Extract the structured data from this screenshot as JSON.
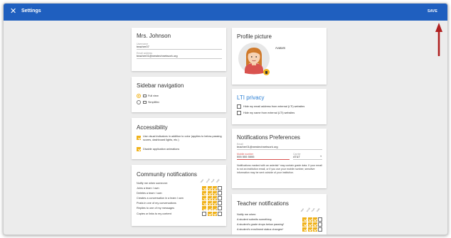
{
  "header": {
    "title": "Settings",
    "save_label": "SAVE",
    "close_icon": "close-icon",
    "color": "#1f5fbf"
  },
  "profile": {
    "name": "Mrs. Johnson",
    "username_label": "Username",
    "username": "teacher07",
    "email_label": "Email address",
    "email": "teacher01@newtechnetwork.org"
  },
  "sidebar_nav": {
    "title": "Sidebar navigation",
    "options": [
      {
        "label": "Full view",
        "selected": true
      },
      {
        "label": "Simplified",
        "selected": false
      }
    ]
  },
  "accessibility": {
    "title": "Accessibility",
    "options": [
      {
        "label": "Use visual indicators in addition to color (applies to below-passing scores, dashboard lights, etc.)",
        "checked": true
      },
      {
        "label": "Disable application animations",
        "checked": true
      }
    ]
  },
  "community": {
    "title": "Community notifications",
    "intro": "Notify me when someone:",
    "columns": [
      "Web",
      "Email",
      "Push",
      "Daily"
    ],
    "rows": [
      {
        "label": "Joins a team I own",
        "checks": [
          true,
          true,
          true,
          false
        ]
      },
      {
        "label": "Deletes a team I own",
        "checks": [
          true,
          true,
          true,
          false
        ]
      },
      {
        "label": "Creates a conversation in a team I own",
        "checks": [
          true,
          true,
          true,
          false
        ]
      },
      {
        "label": "Posts in one of my conversations",
        "checks": [
          true,
          true,
          true,
          false
        ]
      },
      {
        "label": "Replies to one of my messages",
        "checks": [
          true,
          true,
          true,
          false
        ]
      },
      {
        "label": "Copies or links to my content",
        "checks": [
          false,
          true,
          true,
          false
        ]
      }
    ]
  },
  "profile_picture": {
    "title": "Profile picture",
    "avatars_label": "Avatars",
    "accent": "#f0b21a"
  },
  "lti": {
    "title": "LTI privacy",
    "title_color": "#2a7fd4",
    "options": [
      {
        "label": "Hide my email address from external (LTI) websites",
        "checked": false
      },
      {
        "label": "Hide my name from external (LTI) websites",
        "checked": false
      }
    ]
  },
  "notif_prefs": {
    "title": "Notifications Preferences",
    "email_label": "Email",
    "email": "teacher01@newtechnetwork.org",
    "mobile_label": "Mobile number",
    "mobile": "555 555 5555",
    "carrier_label": "Carrier",
    "carrier": "AT&T",
    "note": "Notifications marked with an asterisk* may contain grade data. If your email is not an institution email, or if you use your mobile number, sensitive information may be sent outside of your institution."
  },
  "teacher": {
    "title": "Teacher notifications",
    "intro": "Notify me when:",
    "columns": [
      "Web",
      "Email",
      "Push",
      "Daily"
    ],
    "rows": [
      {
        "label": "A student submits something",
        "checks": [
          true,
          true,
          true,
          false
        ]
      },
      {
        "label": "A student's grade drops below passing*",
        "checks": [
          true,
          true,
          true,
          false
        ]
      },
      {
        "label": "A student's enrollment status changes*",
        "checks": [
          true,
          true,
          true,
          false
        ]
      }
    ]
  }
}
